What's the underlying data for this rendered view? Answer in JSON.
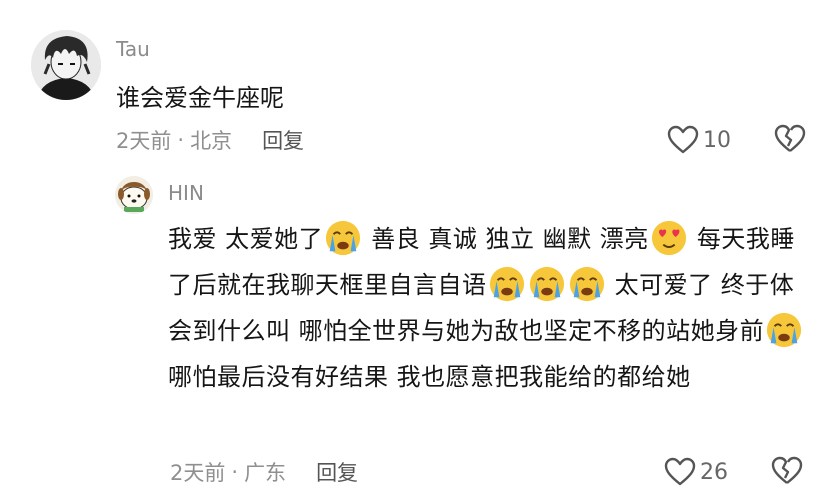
{
  "comment": {
    "username": "Tau",
    "text": "谁会爱金牛座呢",
    "time": "2天前",
    "separator": "·",
    "location": "北京",
    "reply_label": "回复",
    "like_count": "10"
  },
  "reply": {
    "username": "HIN",
    "segments": [
      "我爱  太爱她了",
      "  善良 真诚 独立 幽默 漂亮",
      "  每天我睡了后就在我聊天框里自言自语",
      "  太可爱了  终于体会到什么叫  哪怕全世界与她为敌也坚定不移的站她身前",
      "  哪怕最后没有好结果  我也愿意把我能给的都给她"
    ],
    "time": "2天前",
    "separator": "·",
    "location": "广东",
    "reply_label": "回复",
    "like_count": "26"
  },
  "icons": {
    "like": "heart-outline-icon",
    "dislike": "broken-heart-icon",
    "emoji_cry": "loudly-crying-face-emoji",
    "emoji_love": "heart-eyes-emoji"
  },
  "colors": {
    "text": "#151515",
    "muted": "#8f8f8f",
    "emoji_face": "#f7c73b",
    "tears": "#4aa3e6",
    "hearts": "#e8344c"
  }
}
